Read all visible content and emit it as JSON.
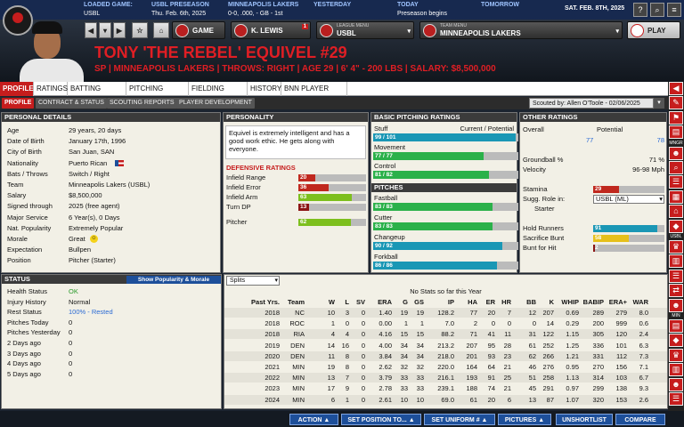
{
  "topbar": {
    "loaded_label": "LOADED GAME:",
    "loaded_value": "USBL",
    "preseason_label": "USBL PRESEASON",
    "preseason_value": "Thu. Feb. 6th, 2025",
    "team_label": "MINNEAPOLIS LAKERS",
    "team_value": "0-0, .000, - GB - 1st",
    "yesterday_label": "YESTERDAY",
    "today_label": "TODAY",
    "today_value": "Preseason begins",
    "tomorrow_label": "TOMORROW",
    "date_label": "SAT. FEB. 8TH, 2025"
  },
  "toolbar": {
    "game_label": "GAME",
    "manager_label": "K. LEWIS",
    "manager_badge": "1",
    "league_small": "LEAGUE MENU",
    "league_label": "USBL",
    "team_small": "TEAM MENU",
    "team_label": "MINNEAPOLIS LAKERS",
    "play_label": "PLAY"
  },
  "player": {
    "name": "TONY 'THE REBEL' EQUIVEL #29",
    "subtitle": "SP | MINNEAPOLIS LAKERS | THROWS: RIGHT | AGE 29 | 6' 4\" - 200 LBS | SALARY: $8,500,000"
  },
  "tabs": [
    "PROFILE",
    "RATINGS",
    "BATTING STATS",
    "PITCHING STATS",
    "FIELDING STATS",
    "HISTORY",
    "BNN PLAYER PAGE"
  ],
  "subtabs": [
    "PROFILE",
    "CONTRACT & STATUS",
    "SCOUTING REPORTS",
    "PLAYER DEVELOPMENT"
  ],
  "scouted_by": "Scouted by: Allen O'Toole - 02/06/2025",
  "personal": {
    "title": "PERSONAL DETAILS",
    "rows": [
      {
        "label": "Age",
        "value": "29 years, 20 days"
      },
      {
        "label": "Date of Birth",
        "value": "January 17th, 1996"
      },
      {
        "label": "City of Birth",
        "value": "San Juan, SAN"
      },
      {
        "label": "Nationality",
        "value": "Puerto Rican"
      },
      {
        "label": "Bats / Throws",
        "value": "Switch / Right"
      },
      {
        "label": "Team",
        "value": "Minneapolis Lakers (USBL)"
      },
      {
        "label": "Salary",
        "value": "$8,500,000"
      },
      {
        "label": "Signed through",
        "value": "2025 (free agent)"
      },
      {
        "label": "Major Service",
        "value": "6 Year(s), 0 Days"
      },
      {
        "label": "Nat. Popularity",
        "value": "Extremely Popular"
      },
      {
        "label": "Morale",
        "value": "Great"
      },
      {
        "label": "Expectation",
        "value": "Bullpen"
      },
      {
        "label": "Position",
        "value": "Pitcher (Starter)"
      }
    ]
  },
  "personality": {
    "title": "PERSONALITY",
    "text": "Equivel is extremely intelligent and has a good work ethic. He gets along with everyone."
  },
  "defensive": {
    "title": "DEFENSIVE RATINGS",
    "rows": [
      {
        "label": "Infield Range",
        "value": "20",
        "fill": 0.25,
        "color": "#c0281e"
      },
      {
        "label": "Infield Error",
        "value": "36",
        "fill": 0.45,
        "color": "#c0281e"
      },
      {
        "label": "Infield Arm",
        "value": "63",
        "fill": 0.79,
        "color": "#7dbf1e"
      },
      {
        "label": "Turn DP",
        "value": "13",
        "fill": 0.16,
        "color": "#8c1414"
      },
      {
        "label": "Pitcher",
        "value": "62",
        "fill": 0.78,
        "color": "#7dbf1e"
      }
    ]
  },
  "pitching": {
    "title": "BASIC PITCHING RATINGS",
    "stuff_label": "Stuff",
    "cp_label": "Current / Potential",
    "stuff": {
      "value": "99 / 101",
      "fill": 0.98,
      "color": "#1a97b5"
    },
    "movement_label": "Movement",
    "movement": {
      "value": "77 / 77",
      "fill": 0.76,
      "color": "#2bb14a"
    },
    "control_label": "Control",
    "control": {
      "value": "81 / 82",
      "fill": 0.8,
      "color": "#2bb14a"
    }
  },
  "pitches": {
    "title": "PITCHES",
    "rows": [
      {
        "label": "Fastball",
        "value": "83 / 83",
        "fill": 0.82,
        "color": "#2bb14a"
      },
      {
        "label": "Cutter",
        "value": "83 / 83",
        "fill": 0.82,
        "color": "#2bb14a"
      },
      {
        "label": "Changeup",
        "value": "90 / 92",
        "fill": 0.89,
        "color": "#1a97b5"
      },
      {
        "label": "Forkball",
        "value": "86 / 86",
        "fill": 0.85,
        "color": "#1a97b5"
      }
    ]
  },
  "other": {
    "title": "OTHER RATINGS",
    "overall_label": "Overall",
    "potential_label": "Potential",
    "overall_value": "77",
    "potential_value": "78",
    "groundball_label": "Groundball %",
    "groundball_value": "71 %",
    "velocity_label": "Velocity",
    "velocity_value": "96-98 Mph",
    "stamina_label": "Stamina",
    "stamina_value": "29",
    "stamina_fill": 0.36,
    "sugg_label": "Sugg. Role in:",
    "sugg_value": "USBL (ML)",
    "starter_label": "Starter",
    "hold_label": "Hold Runners",
    "hold_value": "91",
    "hold_fill": 0.9,
    "sac_label": "Sacrifice Bunt",
    "sac_value": "58",
    "sac_fill": 0.5,
    "bunt_label": "Bunt for Hit",
    "bunt_value": "2",
    "bunt_fill": 0.03
  },
  "status": {
    "title": "STATUS",
    "button": "Show Popularity & Morale",
    "rows": [
      {
        "label": "Health Status",
        "value": "OK",
        "color": "#2a9a2a"
      },
      {
        "label": "Injury History",
        "value": "Normal",
        "color": "#111111"
      },
      {
        "label": "Rest Status",
        "value": "100% - Rested",
        "color": "#2a6ad4"
      },
      {
        "label": "Pitches Today",
        "value": "0",
        "color": "#111111"
      },
      {
        "label": "Pitches Yesterday",
        "value": "0",
        "color": "#111111"
      },
      {
        "label": "2 Days ago",
        "value": "0",
        "color": "#111111"
      },
      {
        "label": "3 Days ago",
        "value": "0",
        "color": "#111111"
      },
      {
        "label": "4 Days ago",
        "value": "0",
        "color": "#111111"
      },
      {
        "label": "5 Days ago",
        "value": "0",
        "color": "#111111"
      }
    ]
  },
  "stats": {
    "splits_label": "Splits",
    "headers": [
      "Past Yrs.",
      "Team",
      "W",
      "L",
      "SV",
      "ERA",
      "G",
      "GS",
      "IP",
      "HA",
      "ER",
      "HR",
      "BB",
      "K",
      "WHIP",
      "BABIP",
      "ERA+",
      "WAR"
    ],
    "none_text": "No Stats so far this Year",
    "rows": [
      [
        "2018",
        "NC (COL)",
        "10",
        "3",
        "0",
        "1.40",
        "19",
        "19",
        "128.2",
        "77",
        "20",
        "7",
        "12",
        "207",
        "0.69",
        "289",
        "279",
        "8.0"
      ],
      [
        "2018",
        "ROC (R)",
        "1",
        "0",
        "0",
        "0.00",
        "1",
        "1",
        "7.0",
        "2",
        "0",
        "0",
        "0",
        "14",
        "0.29",
        "200",
        "999",
        "0.6"
      ],
      [
        "2018",
        "RIA (AAA)",
        "4",
        "4",
        "0",
        "4.16",
        "15",
        "15",
        "88.2",
        "71",
        "41",
        "11",
        "31",
        "122",
        "1.15",
        "305",
        "120",
        "2.4"
      ],
      [
        "2019",
        "DEN",
        "14",
        "16",
        "0",
        "4.00",
        "34",
        "34",
        "213.2",
        "207",
        "95",
        "28",
        "61",
        "252",
        "1.25",
        "336",
        "101",
        "6.3"
      ],
      [
        "2020",
        "DEN",
        "11",
        "8",
        "0",
        "3.84",
        "34",
        "34",
        "218.0",
        "201",
        "93",
        "23",
        "62",
        "266",
        "1.21",
        "331",
        "112",
        "7.3"
      ],
      [
        "2021",
        "MIN",
        "19",
        "8",
        "0",
        "2.62",
        "32",
        "32",
        "220.0",
        "164",
        "64",
        "21",
        "46",
        "276",
        "0.95",
        "270",
        "156",
        "7.1"
      ],
      [
        "2022",
        "MIN",
        "13",
        "7",
        "0",
        "3.79",
        "33",
        "33",
        "216.1",
        "193",
        "91",
        "25",
        "51",
        "258",
        "1.13",
        "314",
        "103",
        "6.7"
      ],
      [
        "2023",
        "MIN",
        "17",
        "9",
        "0",
        "2.78",
        "33",
        "33",
        "239.1",
        "188",
        "74",
        "21",
        "45",
        "291",
        "0.97",
        "299",
        "138",
        "9.3"
      ],
      [
        "2024",
        "MIN",
        "6",
        "1",
        "0",
        "2.61",
        "10",
        "10",
        "69.0",
        "61",
        "20",
        "6",
        "13",
        "87",
        "1.07",
        "320",
        "153",
        "2.6"
      ]
    ]
  },
  "bottom": [
    "ACTION",
    "SET POSITION TO...",
    "SET UNIFORM #",
    "PICTURES",
    "UNSHORTLIST",
    "COMPARE"
  ],
  "side_labels": [
    "MNGR",
    "USBL",
    "MIN"
  ]
}
